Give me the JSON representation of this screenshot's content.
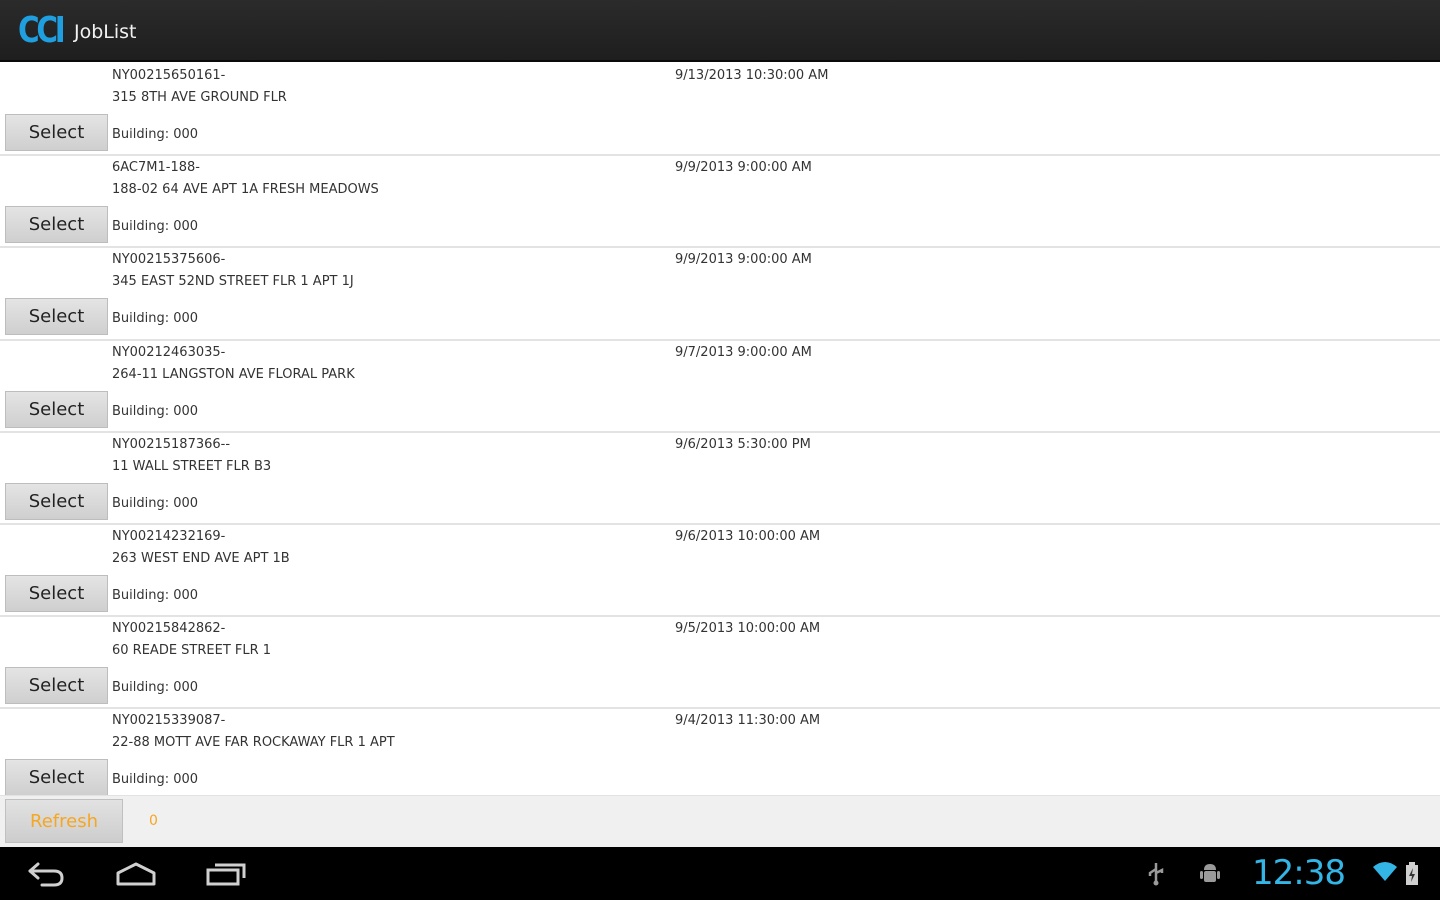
{
  "app": {
    "logo_text": "CCI",
    "title": "JobList"
  },
  "jobs": [
    {
      "id": "NY00215650161-",
      "address": "315 8TH AVE GROUND FLR",
      "building": "Building: 000",
      "date": "9/13/2013 10:30:00 AM",
      "select_label": "Select"
    },
    {
      "id": "6AC7M1-188-",
      "address": "188-02 64 AVE APT 1A FRESH MEADOWS",
      "building": "Building: 000",
      "date": "9/9/2013 9:00:00 AM",
      "select_label": "Select"
    },
    {
      "id": "NY00215375606-",
      "address": "345 EAST 52ND STREET FLR 1 APT 1J",
      "building": "Building: 000",
      "date": "9/9/2013 9:00:00 AM",
      "select_label": "Select"
    },
    {
      "id": "NY00212463035-",
      "address": "264-11 LANGSTON AVE FLORAL PARK",
      "building": "Building: 000",
      "date": "9/7/2013 9:00:00 AM",
      "select_label": "Select"
    },
    {
      "id": "NY00215187366--",
      "address": "11 WALL STREET FLR B3",
      "building": "Building: 000",
      "date": "9/6/2013 5:30:00 PM",
      "select_label": "Select"
    },
    {
      "id": "NY00214232169-",
      "address": "263 WEST END AVE APT 1B",
      "building": "Building: 000",
      "date": "9/6/2013 10:00:00 AM",
      "select_label": "Select"
    },
    {
      "id": "NY00215842862-",
      "address": "60 READE STREET FLR 1",
      "building": "Building: 000",
      "date": "9/5/2013 10:00:00 AM",
      "select_label": "Select"
    },
    {
      "id": "NY00215339087-",
      "address": "22-88 MOTT AVE FAR ROCKAWAY FLR 1 APT",
      "building": "Building: 000",
      "date": "9/4/2013 11:30:00 AM",
      "select_label": "Select"
    }
  ],
  "toolbar": {
    "refresh_label": "Refresh",
    "count": "0"
  },
  "system_bar": {
    "time": "12:38",
    "nav_icons": [
      "back-icon",
      "home-icon",
      "recent-apps-icon"
    ],
    "status_icons": [
      "usb-icon",
      "android-debug-icon",
      "wifi-icon",
      "battery-icon"
    ]
  },
  "colors": {
    "logo": "#1f9fe0",
    "accent_orange": "#f5a623",
    "clock": "#33b5e5"
  }
}
